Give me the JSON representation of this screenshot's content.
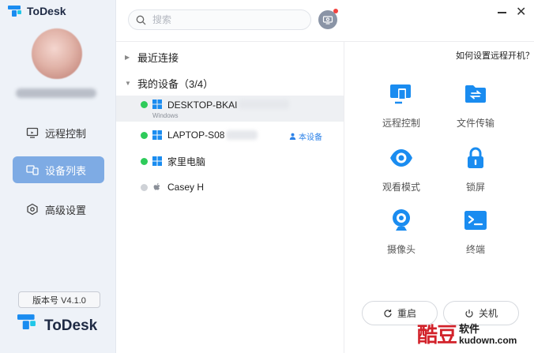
{
  "app": {
    "title": "ToDesk",
    "brand_color": "#1a8cf0"
  },
  "sidebar": {
    "items": [
      {
        "label": "远程控制",
        "icon": "remote-control-icon",
        "active": false
      },
      {
        "label": "设备列表",
        "icon": "device-list-icon",
        "active": true
      },
      {
        "label": "高级设置",
        "icon": "advanced-settings-icon",
        "active": false
      }
    ],
    "version": "版本号 V4.1.0",
    "bottom_logo": "ToDesk"
  },
  "search": {
    "placeholder": "搜索"
  },
  "groups": {
    "recent": {
      "label": "最近连接",
      "expanded": false
    },
    "mine": {
      "label": "我的设备（3/4）",
      "expanded": true
    }
  },
  "devices": [
    {
      "name": "DESKTOP-BKAI",
      "os": "windows-icon",
      "online": true,
      "sub": "Windows",
      "selected": true
    },
    {
      "name": "LAPTOP-S08",
      "os": "windows-icon",
      "online": true,
      "tag": "本设备"
    },
    {
      "name": "家里电脑",
      "os": "windows-icon",
      "online": true
    },
    {
      "name": "Casey H",
      "os": "apple-icon",
      "online": false
    }
  ],
  "panel": {
    "help_link": "如何设置远程开机？",
    "actions": [
      {
        "label": "远程控制",
        "icon": "remote-desktop-icon"
      },
      {
        "label": "文件传输",
        "icon": "file-transfer-icon"
      },
      {
        "label": "观看模式",
        "icon": "eye-icon"
      },
      {
        "label": "锁屏",
        "icon": "lock-icon"
      },
      {
        "label": "摄像头",
        "icon": "camera-icon"
      },
      {
        "label": "终端",
        "icon": "terminal-icon"
      }
    ],
    "restart_label": "重启",
    "shutdown_label": "关机"
  },
  "watermark": {
    "big": "酷豆",
    "small": "软件",
    "url": "kudown.com"
  },
  "colors": {
    "accent": "#7eabe4",
    "online": "#2ecb5a",
    "offline": "#cfd2d7",
    "link": "#2d82e8",
    "notification": "#f2433f"
  }
}
